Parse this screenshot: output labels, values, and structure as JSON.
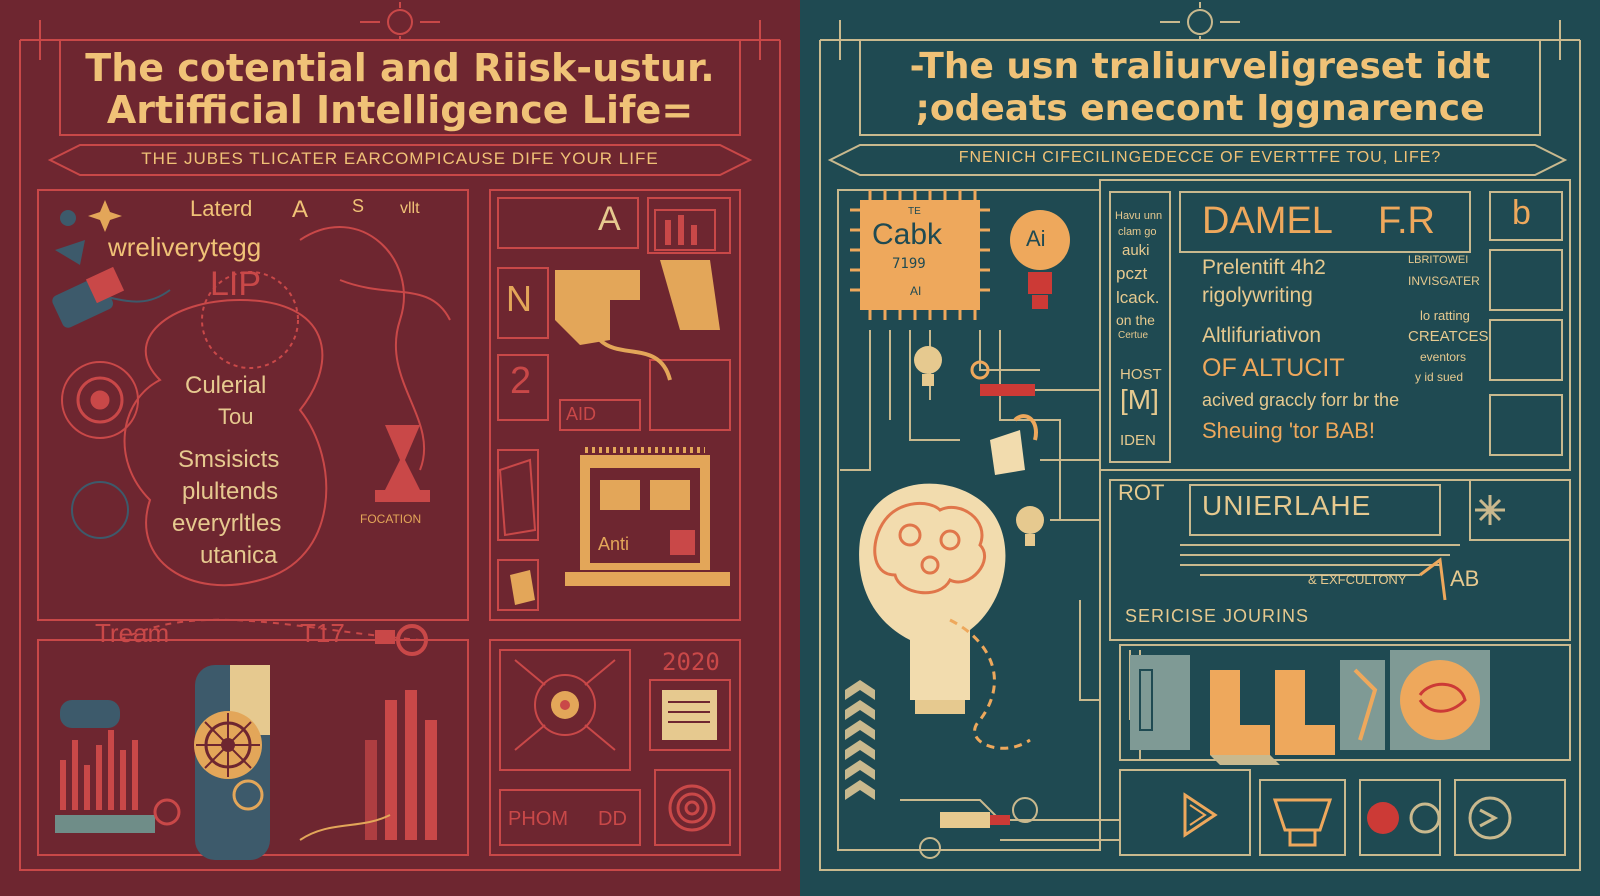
{
  "colors": {
    "left_bg": "#6e2630",
    "left_line": "#c94848",
    "left_accent": "#e3a659",
    "left_blue": "#3d5a6b",
    "right_bg": "#1f4a52",
    "right_line": "#c9b98e",
    "right_accent": "#eea85c",
    "right_red": "#cc3a36"
  },
  "left": {
    "title_line1": "The cotential and Riisk-ustur.",
    "title_line2": "Artifficial Intelligence Life=",
    "banner": "THE JUBES TLICATER EARCOMPICAUSE DIFE YOUR LIFE",
    "scribble_1": "Laterd",
    "scribble_2": "A",
    "scribble_3": "S",
    "scribble_4": "wreliverytegg",
    "scribble_5": "LIP",
    "scribble_6": "vllt",
    "oval_line1": "Culerial",
    "oval_line2": "Tou",
    "oval_line3": "Smsisicts",
    "oval_line4": "plultends",
    "oval_line5": "everyrltles",
    "oval_line6": "utanica",
    "focation": "FOCATION",
    "tream": "Tream",
    "t17": "T17",
    "box_a": "A",
    "box_n": "N",
    "box_2": "2",
    "box_aid": "AID",
    "year": "2020",
    "phom": "PHOM",
    "dd": "DD",
    "laptop_label": "Anti"
  },
  "right": {
    "title_line1": "-The usn traliurveligreset idt",
    "title_line2": ";odeats enecont Iggnarence",
    "banner": "FNENICH CIFECILINGEDECCE OF EVERTTFE TOU, LIFE?",
    "chip_small": "TE",
    "chip_big": "Cabk",
    "chip_num": "7199",
    "chip_ai": "AI",
    "bulb_ai": "Ai",
    "col_1": "Havu unn",
    "col_2": "clam go",
    "col_3": "auki",
    "col_4": "pczt",
    "col_5": "lcack.",
    "col_6": "on the",
    "col_7": "Certue",
    "host": "HOST",
    "m_box": "[M]",
    "iden": "IDEN",
    "damel": "DAMEL",
    "dr": "F.R",
    "b_glyph": "b",
    "text_1": "Prelentift 4h2",
    "text_2": "rigolywriting",
    "text_3": "Altlifuriativon",
    "text_4": "OF ALTUCIT",
    "text_5": "acived graccly forr br the",
    "text_6": "Sheuing 'tor BAB!",
    "side_1": "LBRITOWEI",
    "side_2": "INVISGATER",
    "side_3": "lo ratting",
    "side_4": "CREATCES",
    "side_5": "eventors",
    "side_6": "y id sued",
    "rot": "ROT",
    "unierlahe": "UNIERLAHE",
    "exfcultony": "& EXFCULTONY",
    "sericise": "SERICISE JOURINS",
    "ab": "AB"
  },
  "icons": [
    "target-icon",
    "lightbulb-head-icon",
    "chip-icon",
    "laptop-icon",
    "gear-icon",
    "bar-chart-icon",
    "arrow-icon",
    "sparkle-icon"
  ]
}
